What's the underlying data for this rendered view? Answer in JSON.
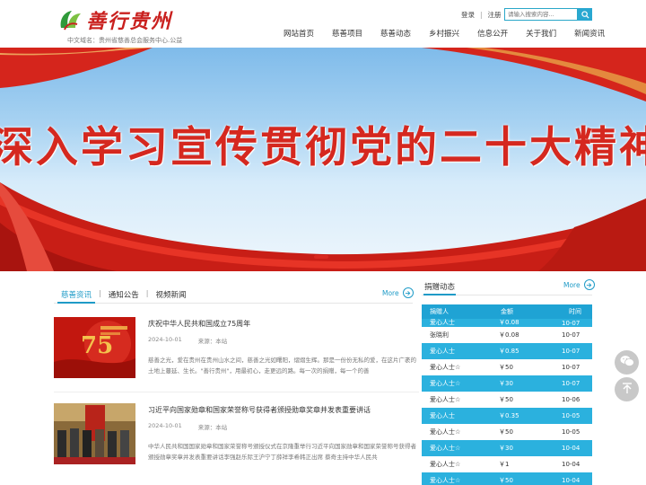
{
  "header": {
    "logo_title": "善行贵州",
    "domain_line": "中文域名：贵州省慈善总会服务中心.公益",
    "top_links": {
      "login": "登录",
      "separator": "|",
      "register": "注册"
    },
    "search": {
      "placeholder": "请输入搜索内容..."
    },
    "nav": [
      {
        "label": "网站首页"
      },
      {
        "label": "慈善项目"
      },
      {
        "label": "慈善动态"
      },
      {
        "label": "乡村振兴"
      },
      {
        "label": "信息公开"
      },
      {
        "label": "关于我们"
      },
      {
        "label": "新闻资讯"
      }
    ]
  },
  "banner": {
    "headline": "深入学习宣传贯彻党的二十大精神"
  },
  "news": {
    "tabs": [
      {
        "label": "慈善资讯"
      },
      {
        "label": "通知公告"
      },
      {
        "label": "视频新闻"
      }
    ],
    "more_label": "More",
    "items": [
      {
        "title": "庆祝中华人民共和国成立75周年",
        "date": "2024-10-01",
        "source": "来源：本站",
        "summary": "慈善之光，爱在贵州在贵州山水之间，慈善之光如曙阳，熠熠生辉。那是一份份无私的爱，在这片广袤的土地上蔓延、生长。\"善行贵州\"，用最初心，走更远的路。每一次的捐赠，每一个的善"
      },
      {
        "title": "习近平向国家勋章和国家荣誉称号获得者颁授勋章奖章并发表重要讲话",
        "date": "2024-10-01",
        "source": "来源：本站",
        "summary": "中华人民共和国国家勋章和国家荣誉称号颁授仪式在京隆重举行习近平向国家勋章和国家荣誉称号获得者颁授勋章奖章并发表重要讲话李强赵乐际王沪宁丁薛祥李希韩正出席    蔡奇主持中华人民共"
      }
    ]
  },
  "donations": {
    "title": "捐赠动态",
    "more_label": "More",
    "columns": {
      "donor": "捐赠人",
      "amount": "金额",
      "time": "时间"
    },
    "partial_row": {
      "donor": "爱心人士",
      "amount": "￥0.08",
      "time": "10-07"
    },
    "rows": [
      {
        "donor": "张晓利",
        "amount": "￥0.08",
        "time": "10-07"
      },
      {
        "donor": "爱心人士",
        "amount": "￥0.85",
        "time": "10-07"
      },
      {
        "donor": "爱心人士☆",
        "amount": "￥50",
        "time": "10-07"
      },
      {
        "donor": "爱心人士☆",
        "amount": "￥30",
        "time": "10-07"
      },
      {
        "donor": "爱心人士☆",
        "amount": "￥50",
        "time": "10-06"
      },
      {
        "donor": "爱心人士",
        "amount": "￥0.35",
        "time": "10-05"
      },
      {
        "donor": "爱心人士☆",
        "amount": "￥50",
        "time": "10-05"
      },
      {
        "donor": "爱心人士☆",
        "amount": "￥30",
        "time": "10-04"
      },
      {
        "donor": "爱心人士☆",
        "amount": "￥1",
        "time": "10-04"
      },
      {
        "donor": "爱心人士☆",
        "amount": "￥50",
        "time": "10-04"
      }
    ]
  },
  "colors": {
    "accent_blue": "#1f9bc7",
    "table_blue": "#2bb1de",
    "brand_red": "#c9201e"
  },
  "floating": {
    "wechat_icon": "wechat-icon",
    "top_icon": "back-to-top-icon"
  }
}
